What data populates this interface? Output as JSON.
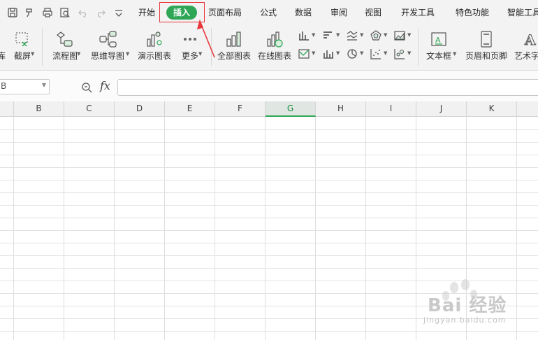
{
  "menu": {
    "tabs": [
      "开始",
      "插入",
      "页面布局",
      "公式",
      "数据",
      "审阅",
      "视图",
      "开发工具",
      "特色功能",
      "智能工具"
    ],
    "active_tab": "插入"
  },
  "ribbon": {
    "partial_left": "库",
    "screenshot": "截屏",
    "flowchart": "流程图",
    "mindmap": "思维导图",
    "demo_chart": "演示图表",
    "more": "更多",
    "all_charts": "全部图表",
    "online_charts": "在线图表",
    "textbox": "文本框",
    "header_footer": "页眉和页脚",
    "art_text": "艺术字"
  },
  "formula_bar": {
    "name_box_value": "B",
    "fx_label": "fx",
    "formula_value": ""
  },
  "grid": {
    "columns": [
      "B",
      "C",
      "D",
      "E",
      "F",
      "G",
      "H",
      "I",
      "J",
      "K"
    ],
    "selected_column": "G"
  },
  "watermark": {
    "text": "Bai 经验",
    "url": "jingyan.baidu.com"
  },
  "colors": {
    "accent_green": "#2ea655",
    "annotation_red": "#e8353a"
  }
}
